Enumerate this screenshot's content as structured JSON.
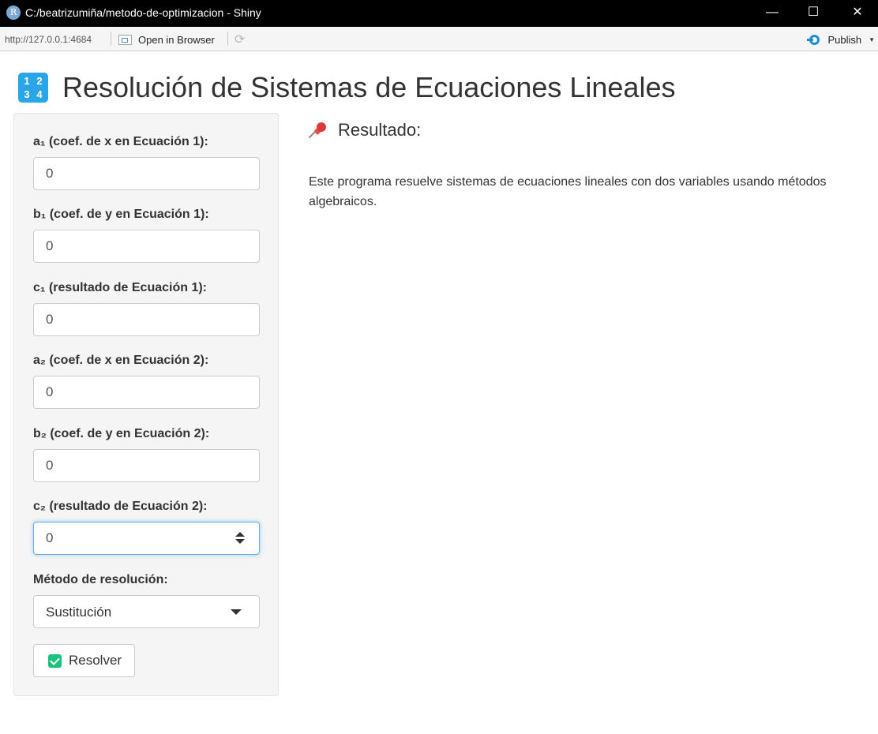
{
  "window": {
    "title": "C:/beatrizumiña/metodo-de-optimizacion - Shiny",
    "minimize": "—",
    "maximize": "☐",
    "close": "✕"
  },
  "toolbar": {
    "url": "http://127.0.0.1:4684",
    "open_in_browser": "Open in Browser",
    "publish": "Publish"
  },
  "page": {
    "icon_digits": [
      "1",
      "2",
      "3",
      "4"
    ],
    "title": "Resolución de Sistemas de Ecuaciones Lineales"
  },
  "form": {
    "fields": [
      {
        "label": "a₁ (coef. de x en Ecuación 1):",
        "value": "0"
      },
      {
        "label": "b₁ (coef. de y en Ecuación 1):",
        "value": "0"
      },
      {
        "label": "c₁ (resultado de Ecuación 1):",
        "value": "0"
      },
      {
        "label": "a₂ (coef. de x en Ecuación 2):",
        "value": "0"
      },
      {
        "label": "b₂ (coef. de y en Ecuación 2):",
        "value": "0"
      },
      {
        "label": "c₂ (resultado de Ecuación 2):",
        "value": "0"
      }
    ],
    "method_label": "Método de resolución:",
    "method_value": "Sustitución",
    "resolve_button": "Resolver"
  },
  "result": {
    "title": "Resultado:",
    "text": "Este programa resuelve sistemas de ecuaciones lineales con dos variables usando métodos algebraicos."
  }
}
